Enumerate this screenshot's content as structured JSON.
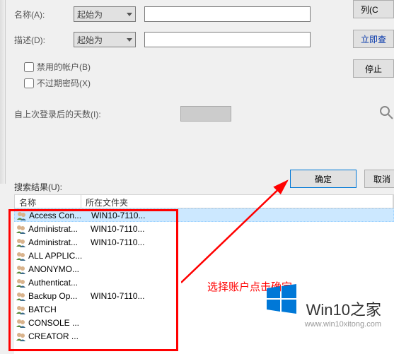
{
  "form": {
    "name_label": "名称(A):",
    "desc_label": "描述(D):",
    "combo_value": "起始为",
    "name_value": "",
    "desc_value": "",
    "chk_disabled": "禁用的帐户(B)",
    "chk_noexpire": "不过期密码(X)",
    "days_label": "自上次登录后的天数(I):"
  },
  "buttons": {
    "columns": "列(C",
    "find_now": "立即查",
    "stop": "停止",
    "ok": "确定",
    "cancel": "取消"
  },
  "results": {
    "label": "搜索结果(U):",
    "col_name": "名称",
    "col_folder": "所在文件夹",
    "rows": [
      {
        "name": "Access Con...",
        "folder": "WIN10-7110...",
        "selected": true
      },
      {
        "name": "Administrat...",
        "folder": "WIN10-7110..."
      },
      {
        "name": "Administrat...",
        "folder": "WIN10-7110..."
      },
      {
        "name": "ALL APPLIC...",
        "folder": ""
      },
      {
        "name": "ANONYMO...",
        "folder": ""
      },
      {
        "name": "Authenticat...",
        "folder": ""
      },
      {
        "name": "Backup Op...",
        "folder": "WIN10-7110..."
      },
      {
        "name": "BATCH",
        "folder": ""
      },
      {
        "name": "CONSOLE ...",
        "folder": ""
      },
      {
        "name": "CREATOR ...",
        "folder": ""
      }
    ]
  },
  "annotation": "选择账户点击确定",
  "logo": {
    "text": "Win10之家",
    "url": "www.win10xitong.com"
  },
  "colors": {
    "accent": "#0078d7",
    "red": "#ff0000"
  }
}
